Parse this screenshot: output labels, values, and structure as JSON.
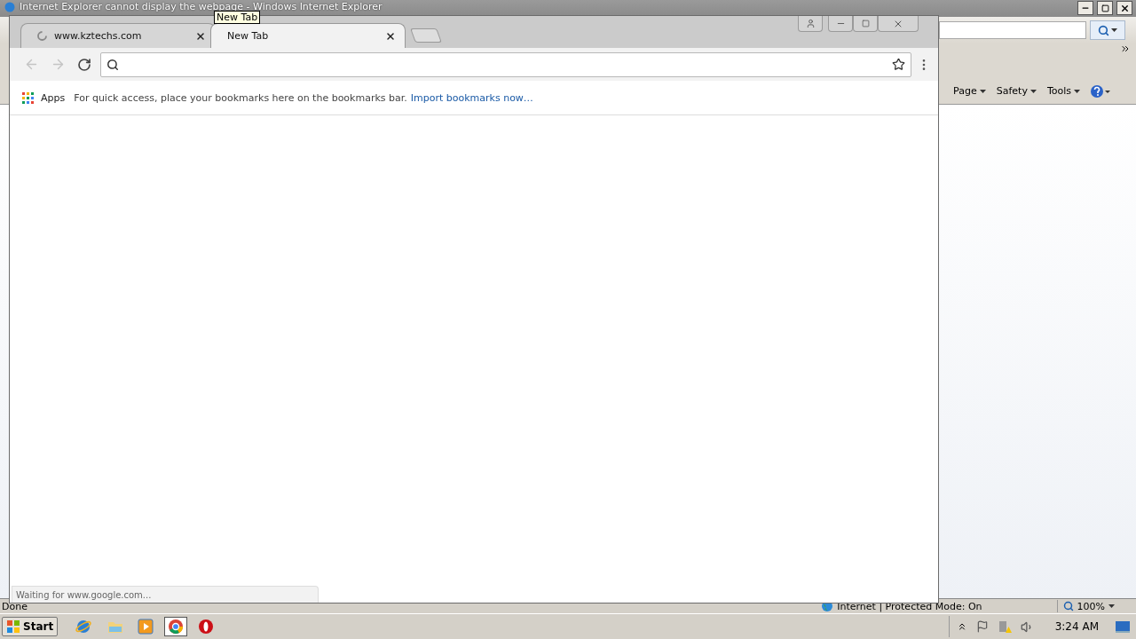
{
  "ie_window": {
    "title": "Internet Explorer cannot display the webpage - Windows Internet Explorer",
    "command_bar": [
      {
        "label": "Page"
      },
      {
        "label": "Safety"
      },
      {
        "label": "Tools"
      }
    ],
    "status": "Done",
    "zone": "Internet | Protected Mode: On",
    "zoom": "100%"
  },
  "browser": {
    "tabs": [
      {
        "title": "www.kztechs.com",
        "selected": false,
        "loading": true
      },
      {
        "title": "New Tab",
        "selected": true,
        "loading": false
      }
    ],
    "tooltip": "New Tab",
    "navigation": [
      {
        "kind": "back",
        "disabled": true
      },
      {
        "kind": "forward",
        "disabled": true
      },
      {
        "kind": "reload",
        "disabled": false
      }
    ],
    "bookmarks_bar": {
      "apps": "Apps",
      "message": "For quick access, place your bookmarks here on the bookmarks bar.",
      "link": "Import bookmarks now…"
    },
    "status_bubble": "Waiting for www.google.com..."
  },
  "taskbar": {
    "start": "Start",
    "apps": [
      {
        "kind": "ie",
        "selected": false
      },
      {
        "kind": "folder",
        "selected": false
      },
      {
        "kind": "media",
        "selected": false
      },
      {
        "kind": "chrome",
        "selected": true
      },
      {
        "kind": "opera",
        "selected": false
      }
    ],
    "clock": "3:24 AM"
  }
}
